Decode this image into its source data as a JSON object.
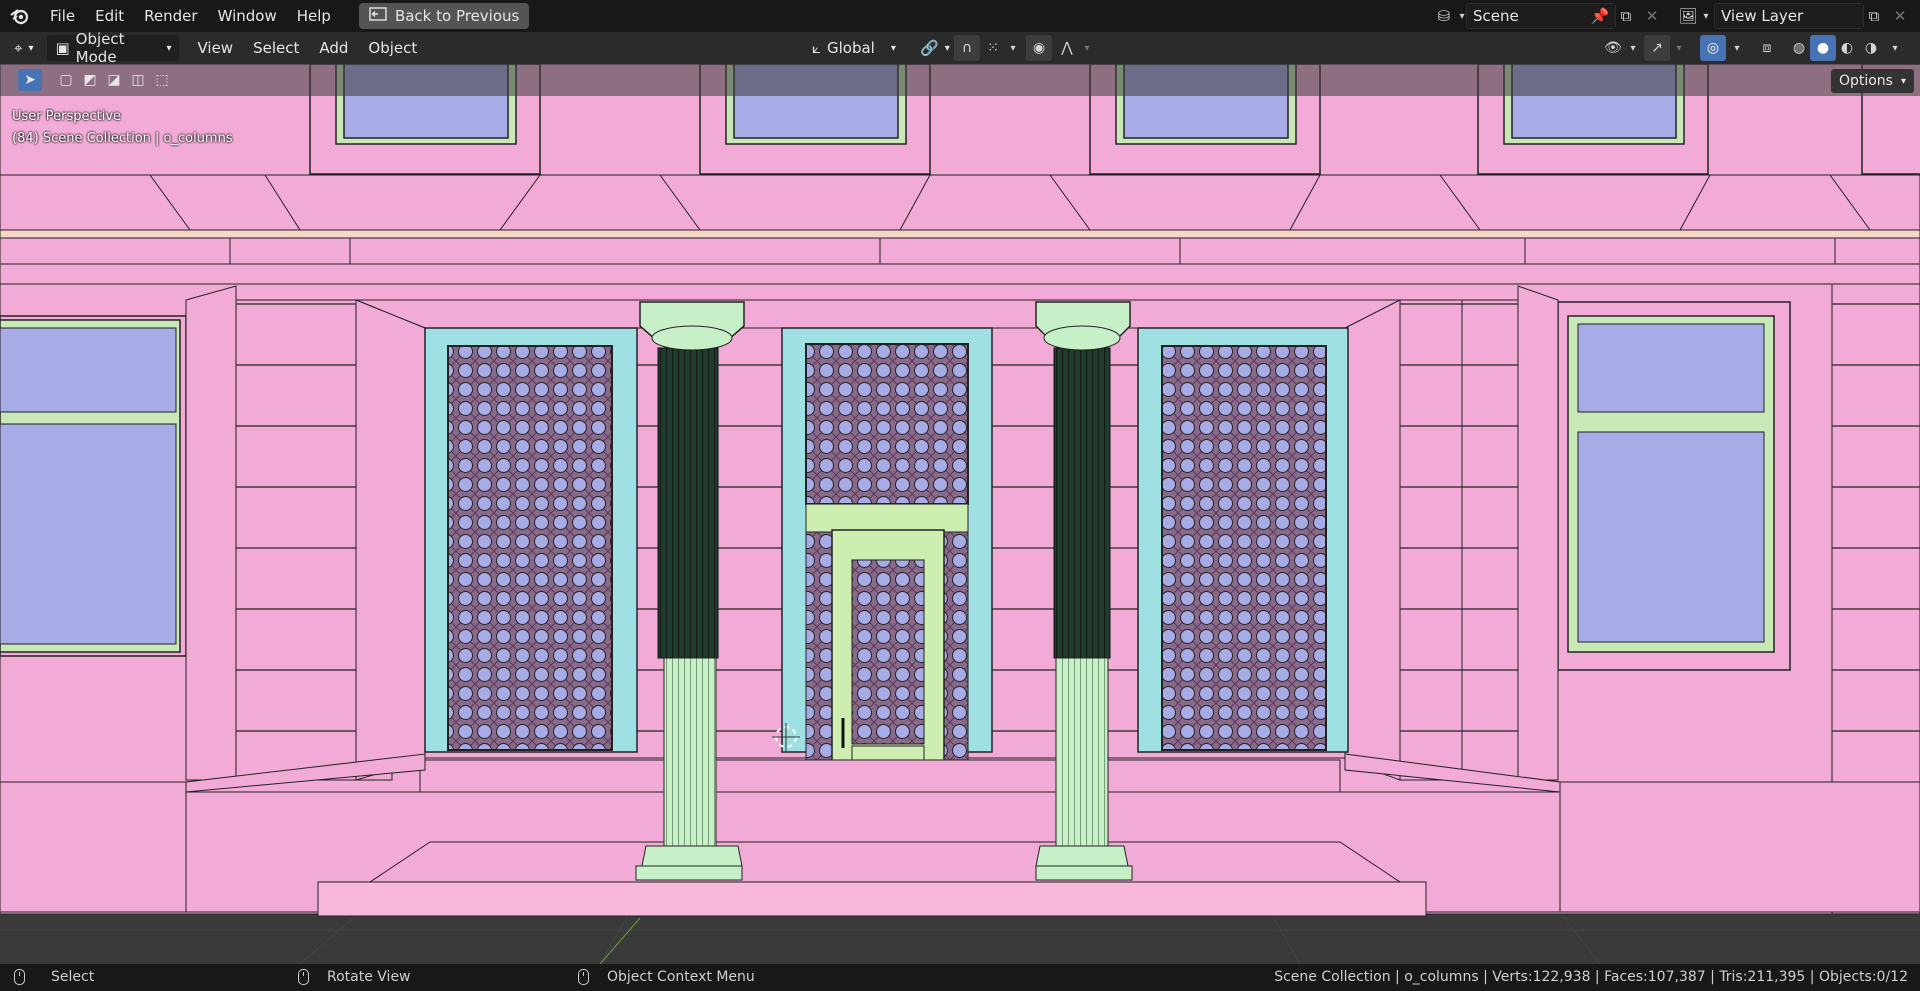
{
  "menubar": {
    "items": [
      "File",
      "Edit",
      "Render",
      "Window",
      "Help"
    ],
    "back_label": "Back to Previous",
    "scene_name": "Scene",
    "view_layer": "View Layer"
  },
  "viewport_header": {
    "mode": "Object Mode",
    "menus": [
      "View",
      "Select",
      "Add",
      "Object"
    ],
    "transform_orientation": "Global"
  },
  "viewport": {
    "perspective_label": "User Perspective",
    "collection_label": "(84) Scene Collection | o_columns",
    "options_label": "Options"
  },
  "statusbar": {
    "hint_select": "Select",
    "hint_rotate": "Rotate View",
    "hint_context": "Object Context Menu",
    "stats": "Scene Collection | o_columns | Verts:122,938 | Faces:107,387 | Tris:211,395 | Objects:0/12"
  },
  "colors": {
    "wall": "#f2aad6",
    "glass": "#a7abe6",
    "frame_cyan": "#9fe0e3",
    "column_green": "#c8f0c8",
    "column_dark": "#1e3b2e",
    "door": "#cdeeb0",
    "accent": "#4772b3"
  }
}
